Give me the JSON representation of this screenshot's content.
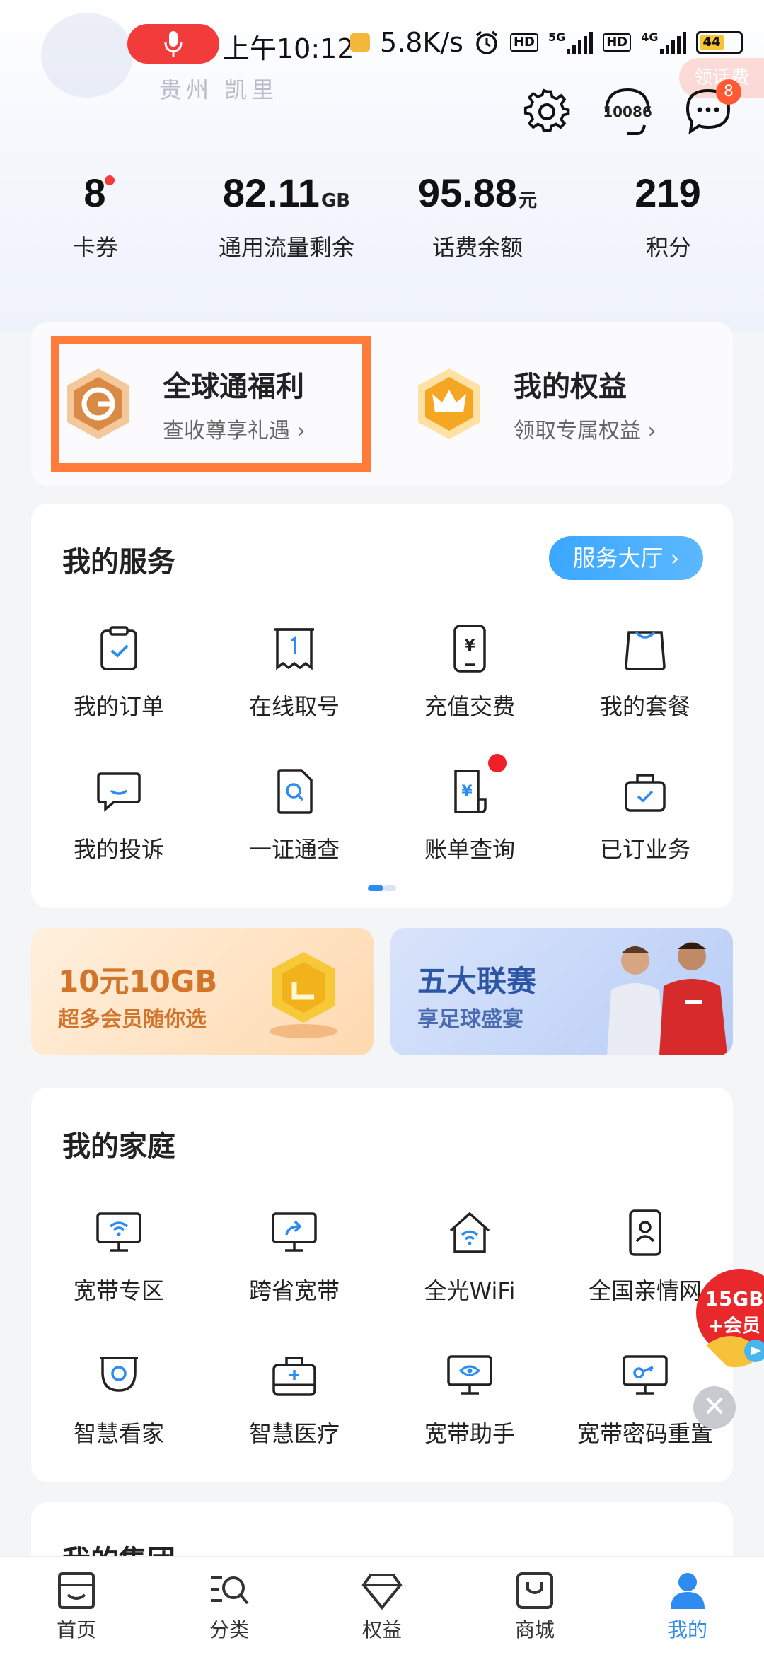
{
  "status_bar": {
    "time": "上午10:12",
    "net_speed": "5.8K/s",
    "hd1": "HD",
    "net1": "5G",
    "hd2": "HD",
    "net2": "4G",
    "battery": "44"
  },
  "profile": {
    "location": "贵州 凯里",
    "corner_badge": "领话费"
  },
  "header_icons": {
    "hotline": "10086",
    "message_count": "8"
  },
  "stats": [
    {
      "value": "8",
      "unit": "",
      "label": "卡券"
    },
    {
      "value": "82.11",
      "unit": "GB",
      "label": "通用流量剩余"
    },
    {
      "value": "95.88",
      "unit": "元",
      "label": "话费余额"
    },
    {
      "value": "219",
      "unit": "",
      "label": "积分"
    }
  ],
  "welfare": {
    "left": {
      "title": "全球通福利",
      "subtitle": "查收尊享礼遇 ›"
    },
    "right": {
      "title": "我的权益",
      "subtitle": "领取专属权益 ›"
    }
  },
  "services": {
    "title": "我的服务",
    "hall_button": "服务大厅 ›",
    "items": [
      {
        "label": "我的订单",
        "icon": "clipboard-check-icon"
      },
      {
        "label": "在线取号",
        "icon": "ticket-number-icon"
      },
      {
        "label": "充值交费",
        "icon": "phone-yuan-icon"
      },
      {
        "label": "我的套餐",
        "icon": "shopping-bag-icon"
      },
      {
        "label": "我的投诉",
        "icon": "chat-bubble-icon"
      },
      {
        "label": "一证通查",
        "icon": "document-search-icon"
      },
      {
        "label": "账单查询",
        "icon": "bill-icon"
      },
      {
        "label": "已订业务",
        "icon": "briefcase-check-icon"
      }
    ]
  },
  "banners": {
    "left": {
      "title": "10元10GB",
      "subtitle": "超多会员随你选"
    },
    "right": {
      "title": "五大联赛",
      "subtitle": "享足球盛宴"
    }
  },
  "family": {
    "title": "我的家庭",
    "items": [
      {
        "label": "宽带专区",
        "icon": "monitor-wifi-icon"
      },
      {
        "label": "跨省宽带",
        "icon": "monitor-share-icon"
      },
      {
        "label": "全光WiFi",
        "icon": "home-wifi-icon"
      },
      {
        "label": "全国亲情网",
        "icon": "phone-person-icon"
      },
      {
        "label": "智慧看家",
        "icon": "camera-icon"
      },
      {
        "label": "智慧医疗",
        "icon": "medical-kit-icon"
      },
      {
        "label": "宽带助手",
        "icon": "monitor-eye-icon"
      },
      {
        "label": "宽带密码重置",
        "icon": "monitor-key-icon"
      }
    ]
  },
  "group": {
    "title": "我的集团"
  },
  "float_ad": {
    "line1": "15GB",
    "line2": "+会员"
  },
  "tabs": [
    {
      "label": "首页",
      "icon": "home-icon"
    },
    {
      "label": "分类",
      "icon": "category-search-icon"
    },
    {
      "label": "权益",
      "icon": "diamond-icon"
    },
    {
      "label": "商城",
      "icon": "mall-bag-icon"
    },
    {
      "label": "我的",
      "icon": "person-icon"
    }
  ],
  "colors": {
    "accent": "#2e8cf0",
    "highlight": "#ff7b3a",
    "badge": "#ff5a33"
  }
}
